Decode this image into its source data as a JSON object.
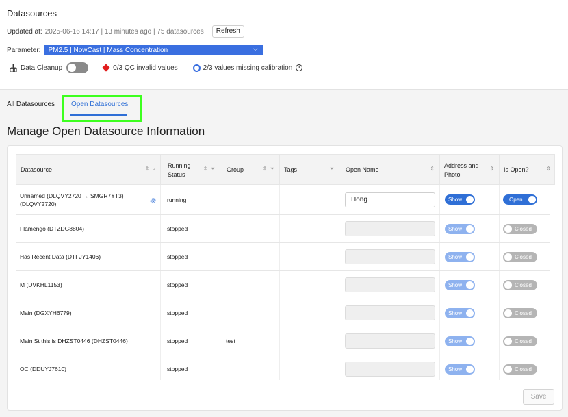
{
  "header": {
    "title": "Datasources",
    "updated_label": "Updated at:",
    "updated_info": "2025-06-16 14:17 | 13 minutes ago | 75 datasources",
    "refresh_label": "Refresh"
  },
  "parameter": {
    "label": "Parameter:",
    "selected": "PM2.5 | NowCast | Mass Concentration",
    "chevron": "⌵"
  },
  "status": {
    "cleanup_label": "Data Cleanup",
    "cleanup_on": false,
    "qc_text": "0/3 QC invalid values",
    "calibration_text": "2/3 values missing calibration",
    "info_glyph": "i",
    "colors": {
      "qc": "#e11d1d",
      "calibration": "#3a6fe0"
    }
  },
  "tabs": [
    {
      "label": "All Datasources",
      "active": false
    },
    {
      "label": "Open Datasources",
      "active": true
    }
  ],
  "section_title": "Manage Open Datasource Information",
  "table": {
    "columns": [
      {
        "label": "Datasource",
        "controls": "⇕ ⌕"
      },
      {
        "label": "Running Status",
        "controls": "⇕ ⏷"
      },
      {
        "label": "Group",
        "controls": "⇕ ⏷"
      },
      {
        "label": "Tags",
        "controls": "⏷"
      },
      {
        "label": "Open Name",
        "controls": "⇕"
      },
      {
        "label": "Address and Photo",
        "controls": "⇕"
      },
      {
        "label": "Is Open?",
        "controls": "⇕"
      }
    ],
    "rows": [
      {
        "datasource": "Unnamed (DLQVY2720 → SMGR7YT3) (DLQVY2720)",
        "status": "running",
        "group": "",
        "tags": "",
        "open_name": "Hong",
        "address": "Show",
        "is_open": "Open"
      },
      {
        "datasource": "Flamengo (DTZDG8804)",
        "status": "stopped",
        "group": "",
        "tags": "",
        "open_name": "",
        "address": "Show",
        "is_open": "Closed"
      },
      {
        "datasource": "Has Recent Data (DTFJY1406)",
        "status": "stopped",
        "group": "",
        "tags": "",
        "open_name": "",
        "address": "Show",
        "is_open": "Closed"
      },
      {
        "datasource": "M (DVKHL1153)",
        "status": "stopped",
        "group": "",
        "tags": "",
        "open_name": "",
        "address": "Show",
        "is_open": "Closed"
      },
      {
        "datasource": "Main (DGXYH6779)",
        "status": "stopped",
        "group": "",
        "tags": "",
        "open_name": "",
        "address": "Show",
        "is_open": "Closed"
      },
      {
        "datasource": "Main St this is DHZST0446 (DHZST0446)",
        "status": "stopped",
        "group": "test",
        "tags": "",
        "open_name": "",
        "address": "Show",
        "is_open": "Closed"
      },
      {
        "datasource": "OC (DDUYJ7610)",
        "status": "stopped",
        "group": "",
        "tags": "",
        "open_name": "",
        "address": "Show",
        "is_open": "Closed"
      }
    ],
    "at_glyph": "@",
    "scroll_up": "▲",
    "scroll_down": "▼"
  },
  "save_label": "Save"
}
